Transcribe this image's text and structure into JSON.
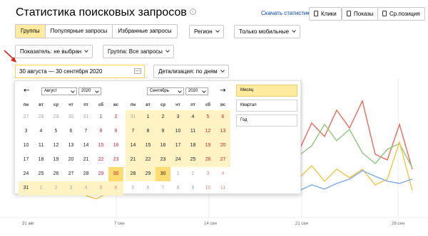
{
  "header": {
    "title": "Статистика поисковых запросов",
    "info_icon": "info-icon",
    "download_link": "Скачать статистику",
    "metric_buttons": [
      "Клики",
      "Показы",
      "Ср.позиция"
    ]
  },
  "query_tabs": [
    "Группы",
    "Популярные запросы",
    "Избранные запросы"
  ],
  "filters": {
    "region": "Регион",
    "device": "Только мобильные",
    "indicator": "Показатель: не выбран",
    "group": "Группа: Все запросы"
  },
  "date_range": {
    "value": "30 августа — 30 сентября 2020",
    "detail": "Детализация: по дням"
  },
  "datepicker": {
    "weekdays": [
      "пн",
      "вт",
      "ср",
      "чт",
      "пт",
      "сб",
      "вс"
    ],
    "left": {
      "month": "Август",
      "year": "2020",
      "days": [
        "27",
        "28",
        "29",
        "30",
        "31",
        "1",
        "2",
        "3",
        "4",
        "5",
        "6",
        "7",
        "8",
        "9",
        "10",
        "11",
        "12",
        "13",
        "14",
        "15",
        "16",
        "17",
        "18",
        "19",
        "20",
        "21",
        "22",
        "23",
        "24",
        "25",
        "26",
        "27",
        "28",
        "29",
        "30",
        "31",
        "1",
        "2",
        "3",
        "4",
        "5",
        "6"
      ]
    },
    "right": {
      "month": "Сентябрь",
      "year": "2020",
      "days": [
        "31",
        "1",
        "2",
        "3",
        "4",
        "5",
        "6",
        "7",
        "8",
        "9",
        "10",
        "11",
        "12",
        "13",
        "14",
        "15",
        "16",
        "17",
        "18",
        "19",
        "20",
        "21",
        "22",
        "23",
        "24",
        "25",
        "26",
        "27",
        "28",
        "29",
        "30",
        "1",
        "2",
        "3",
        "4",
        "5",
        "6",
        "7",
        "8",
        "9",
        "10",
        "11"
      ]
    },
    "periods": [
      "Месяц",
      "Квартал",
      "Год"
    ]
  },
  "chart_data": {
    "type": "line",
    "x_tick_labels": [
      "31 авг",
      "7 сен",
      "14 сен",
      "21 сен",
      "28 сен"
    ],
    "colors": {
      "red": "#f0685a",
      "green": "#8cc77a",
      "yellow": "#f5c63d",
      "blue": "#7aabea"
    }
  }
}
